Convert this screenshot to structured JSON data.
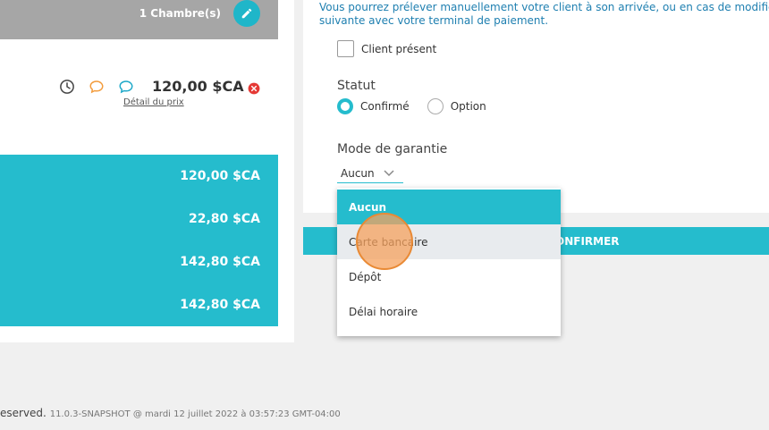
{
  "summary": {
    "rooms_label": "1 Chambre(s)",
    "price": "120,00 $CA",
    "price_detail_link": "Détail du prix",
    "totals": [
      "120,00 $CA",
      "22,80 $CA",
      "142,80 $CA",
      "142,80 $CA"
    ]
  },
  "form": {
    "info_line1": "Vous pourrez prélever manuellement votre client à son arrivée, ou en cas de modificatio",
    "info_line2": "suivante avec votre terminal de paiement.",
    "client_present_label": "Client présent",
    "statut_label": "Statut",
    "statut_options": [
      "Confirmé",
      "Option"
    ],
    "garantie_label": "Mode de garantie",
    "garantie_value": "Aucun",
    "confirm_label": "ONFIRMER"
  },
  "dropdown": {
    "options": [
      "Aucun",
      "Carte bancaire",
      "Dépôt",
      "Délai horaire"
    ]
  },
  "footer": {
    "reserved": "eserved.",
    "version": "11.0.3-SNAPSHOT @ mardi 12 juillet 2022 à 03:57:23 GMT-04:00"
  },
  "colors": {
    "accent": "#25bccd",
    "header_gray": "#a6a6a6",
    "link_blue": "#1e7fb0",
    "remove_red": "#e53935",
    "chat_orange": "#f39c3d"
  }
}
